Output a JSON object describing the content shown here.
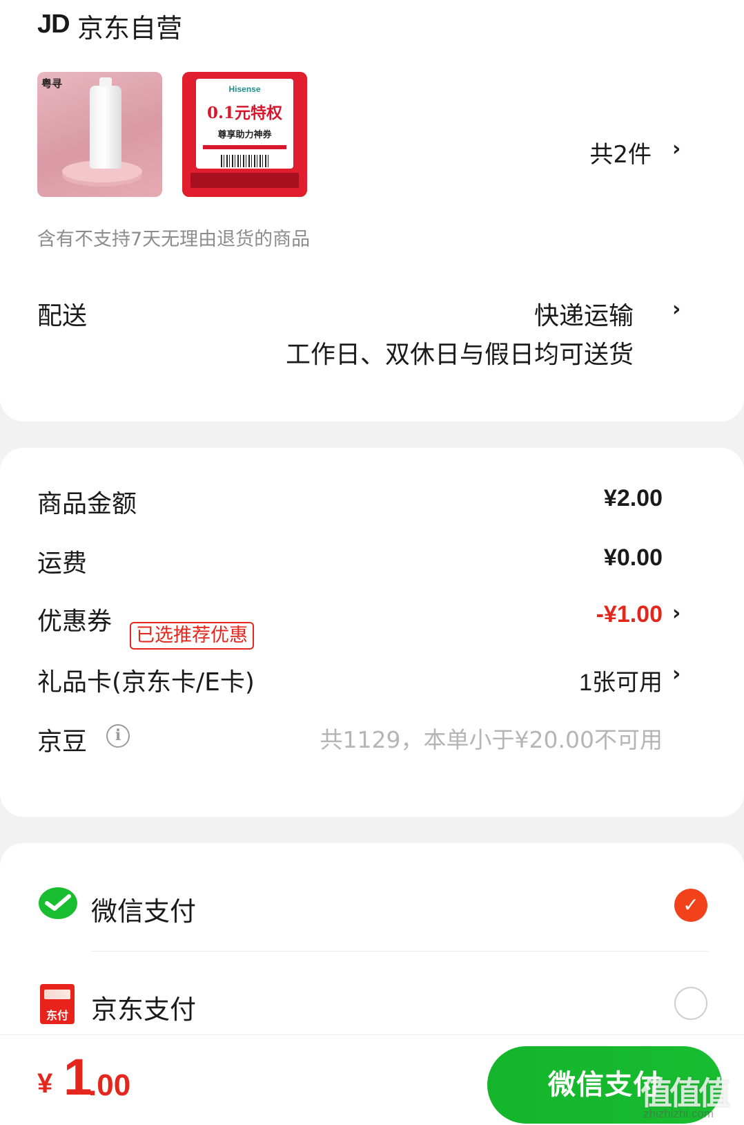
{
  "store": {
    "logo_text": "JD",
    "name": "京东自营",
    "item_count": "共2件",
    "return_note": "含有不支持7天无理由退货的商品",
    "products": [
      {
        "brand_text": "粤寻"
      },
      {
        "brand_text": "Hisense",
        "headline": "0.1元特权",
        "subtitle": "尊享助力神券"
      }
    ]
  },
  "shipping": {
    "label": "配送",
    "method": "快递运输",
    "time": "工作日、双休日与假日均可送货"
  },
  "price": {
    "goods_label": "商品金额",
    "goods_value": "¥2.00",
    "freight_label": "运费",
    "freight_value": "¥0.00",
    "coupon_label": "优惠券",
    "coupon_tag": "已选推荐优惠",
    "coupon_value": "-¥1.00",
    "giftcard_label": "礼品卡(京东卡/E卡)",
    "giftcard_value": "1张可用",
    "beans_label": "京豆",
    "beans_note": "共1129，本单小于¥20.00不可用"
  },
  "payment": {
    "options": [
      {
        "label": "微信支付",
        "selected": true,
        "icon": "wechat-pay-icon"
      },
      {
        "label": "京东支付",
        "selected": false,
        "icon": "jd-pay-icon",
        "icon_text": "东付"
      }
    ]
  },
  "bottom_bar": {
    "currency": "¥",
    "total_int": "1",
    "total_dec": ".00",
    "pay_button": "微信支付",
    "watermark": "值值值",
    "watermark_url": "zhizhizhi.com"
  },
  "colors": {
    "accent_red": "#e4261c",
    "wechat_green": "#18bd30",
    "radio_selected": "#f2421b"
  }
}
